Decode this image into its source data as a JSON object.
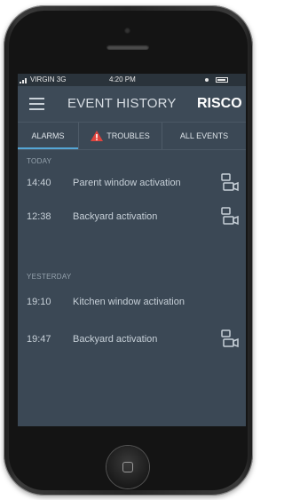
{
  "status_bar": {
    "carrier": "VIRGIN",
    "network": "3G",
    "time": "4:20 PM"
  },
  "header": {
    "title": "EVENT HISTORY",
    "logo": "RISCO"
  },
  "tabs": [
    {
      "label": "ALARMS",
      "active": true
    },
    {
      "label": "TROUBLES",
      "icon": "warning-icon",
      "icon_color": "#e0443e"
    },
    {
      "label": "ALL EVENTS"
    }
  ],
  "sections": [
    {
      "label": "TODAY",
      "events": [
        {
          "time": "14:40",
          "description": "Parent window activation",
          "icon": "camera-icon"
        },
        {
          "time": "12:38",
          "description": "Backyard activation",
          "icon": "camera-icon"
        }
      ]
    },
    {
      "label": "YESTERDAY",
      "events": [
        {
          "time": "19:10",
          "description": "Kitchen window activation"
        },
        {
          "time": "19:47",
          "description": "Backyard activation",
          "icon": "camera-icon"
        }
      ]
    }
  ],
  "colors": {
    "screen_bg": "#3b4855",
    "accent": "#55a6d6",
    "warning": "#e0443e"
  }
}
